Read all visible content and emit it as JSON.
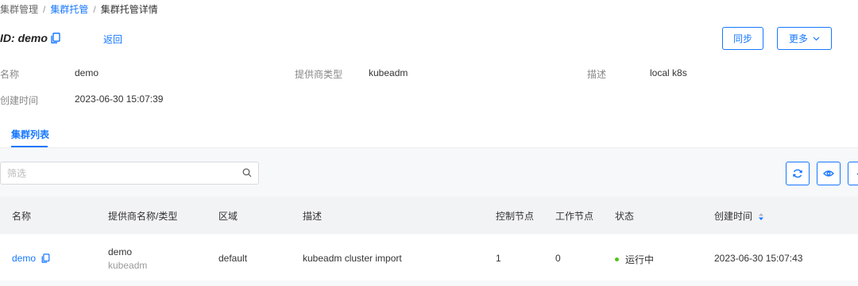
{
  "breadcrumb": {
    "items": [
      "集群管理",
      "集群托管",
      "集群托管详情"
    ],
    "separator": "/"
  },
  "header": {
    "id_label": "ID:",
    "id_value": "demo",
    "back_link": "返回",
    "sync_button": "同步",
    "more_button": "更多"
  },
  "details": {
    "name_label": "名称",
    "name_value": "demo",
    "provider_type_label": "提供商类型",
    "provider_type_value": "kubeadm",
    "description_label": "描述",
    "description_value": "local k8s",
    "created_label": "创建时间",
    "created_value": "2023-06-30 15:07:39"
  },
  "tabs": {
    "active": "集群列表"
  },
  "filter": {
    "placeholder": "筛选"
  },
  "table": {
    "columns": [
      "名称",
      "提供商名称/类型",
      "区域",
      "描述",
      "控制节点",
      "工作节点",
      "状态",
      "创建时间"
    ],
    "rows": [
      {
        "name": "demo",
        "provider_name": "demo",
        "provider_type": "kubeadm",
        "region": "default",
        "description": "kubeadm cluster import",
        "control_nodes": "1",
        "worker_nodes": "0",
        "status": "运行中",
        "created": "2023-06-30 15:07:43"
      }
    ]
  },
  "colors": {
    "accent": "#1677ff",
    "status_running": "#52c41a"
  },
  "icons": [
    "copy-icon",
    "chevron-down-icon",
    "search-icon",
    "refresh-icon",
    "eye-icon",
    "download-icon",
    "sort-icon"
  ]
}
